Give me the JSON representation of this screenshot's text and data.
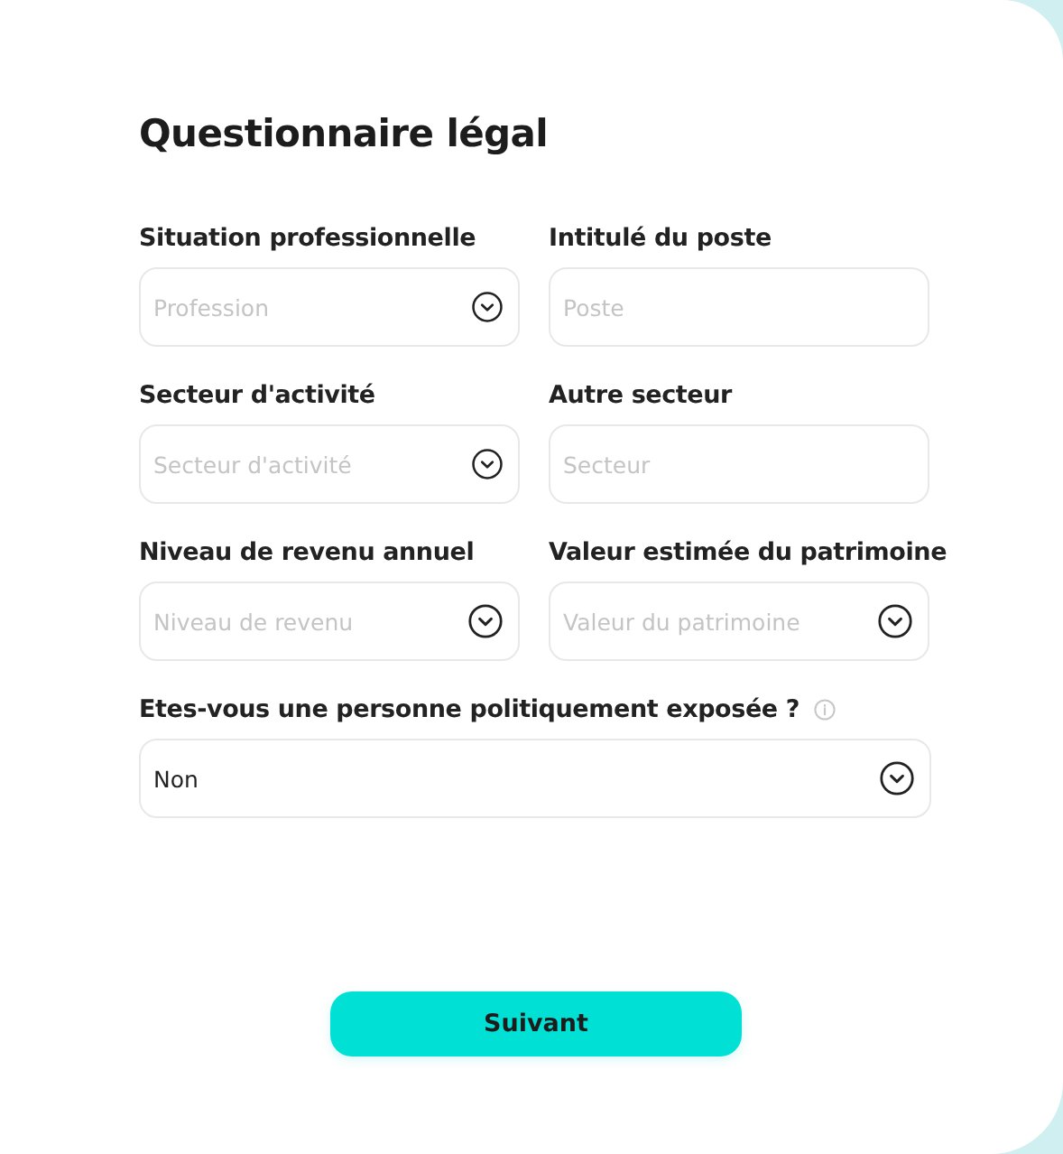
{
  "title": "Questionnaire légal",
  "rows": [
    {
      "fields": [
        {
          "kind": "select",
          "label": "Situation professionnelle",
          "placeholder": "Profession"
        },
        {
          "kind": "text",
          "label": "Intitulé du poste",
          "placeholder": "Poste"
        }
      ]
    },
    {
      "fields": [
        {
          "kind": "select",
          "label": "Secteur d'activité",
          "placeholder": "Secteur d'activité"
        },
        {
          "kind": "text",
          "label": "Autre secteur",
          "placeholder": "Secteur"
        }
      ]
    },
    {
      "fields": [
        {
          "kind": "select",
          "label": "Niveau de revenu annuel",
          "placeholder": "Niveau de revenu"
        },
        {
          "kind": "select",
          "label": "Valeur estimée du patrimoine",
          "placeholder": "Valeur du patrimoine"
        }
      ]
    },
    {
      "fields": [
        {
          "kind": "select",
          "label": "Etes-vous une personne politiquement exposée ?",
          "value": "Non",
          "info": true
        }
      ]
    }
  ],
  "next_button": "Suivant"
}
